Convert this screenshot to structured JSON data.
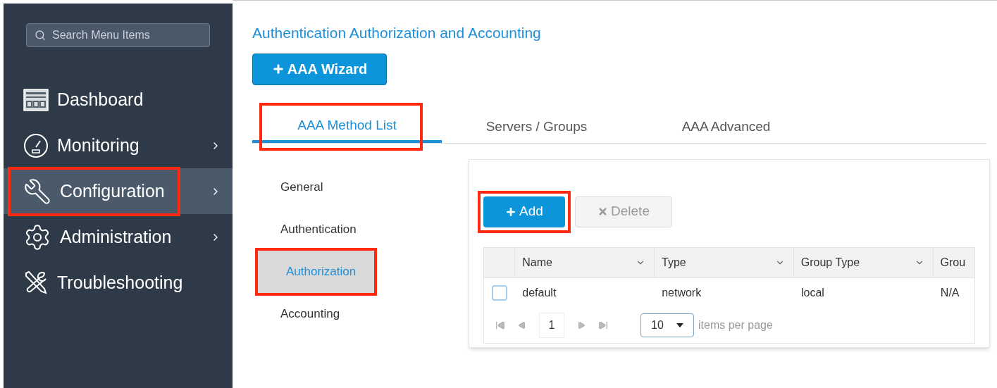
{
  "sidebar": {
    "search": {
      "placeholder": "Search Menu Items"
    },
    "items": [
      {
        "label": "Dashboard",
        "kind": "dashboard",
        "has_submenu": false,
        "selected": false,
        "highlighted": false
      },
      {
        "label": "Monitoring",
        "kind": "gauge",
        "has_submenu": true,
        "selected": false,
        "highlighted": false
      },
      {
        "label": "Configuration",
        "kind": "wrench",
        "has_submenu": true,
        "selected": true,
        "highlighted": true
      },
      {
        "label": "Administration",
        "kind": "gear",
        "has_submenu": true,
        "selected": false,
        "highlighted": false
      },
      {
        "label": "Troubleshooting",
        "kind": "tools",
        "has_submenu": false,
        "selected": false,
        "highlighted": false
      }
    ]
  },
  "page": {
    "title": "Authentication Authorization and Accounting",
    "wizard_button": "AAA Wizard",
    "tabs": [
      {
        "label": "AAA Method List",
        "selected": true,
        "highlighted": true
      },
      {
        "label": "Servers / Groups",
        "selected": false,
        "highlighted": false
      },
      {
        "label": "AAA Advanced",
        "selected": false,
        "highlighted": false
      }
    ],
    "subnav": [
      {
        "label": "General",
        "selected": false,
        "highlighted": false
      },
      {
        "label": "Authentication",
        "selected": false,
        "highlighted": false
      },
      {
        "label": "Authorization",
        "selected": true,
        "highlighted": true
      },
      {
        "label": "Accounting",
        "selected": false,
        "highlighted": false
      }
    ],
    "toolbar": [
      {
        "label": "Add",
        "kind": "add",
        "disabled": false,
        "highlighted": true
      },
      {
        "label": "Delete",
        "kind": "delete",
        "disabled": true,
        "highlighted": false
      }
    ],
    "table": {
      "columns": [
        "Name",
        "Type",
        "Group Type",
        "Grou"
      ],
      "rows": [
        {
          "checked": false,
          "cells": [
            "default",
            "network",
            "local",
            "N/A"
          ]
        }
      ]
    },
    "pagination": {
      "page": "1",
      "page_size": "10",
      "suffix": "items per page"
    }
  }
}
